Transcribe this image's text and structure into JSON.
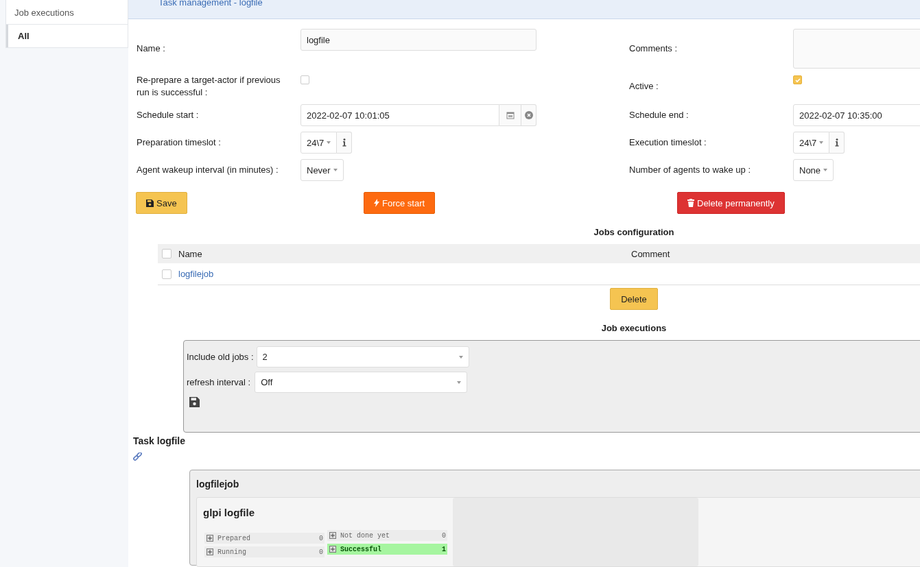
{
  "sidebar": {
    "title": "Job executions",
    "items": [
      {
        "label": "All",
        "selected": true
      }
    ]
  },
  "header": {
    "title": "Task management - logfile"
  },
  "form": {
    "rows": [
      {
        "left": {
          "label": "Name :",
          "kind": "text",
          "value": "logfile"
        },
        "right": {
          "label": "Comments :",
          "kind": "textarea"
        }
      },
      {
        "left": {
          "label": "Re-prepare a target-actor if previous run is successful :",
          "kind": "checkbox",
          "checked": false
        },
        "right": {
          "label": "Active :",
          "kind": "checkbox",
          "checked": true
        }
      },
      {
        "left": {
          "label": "Schedule start :",
          "kind": "date",
          "value": "2022-02-07 10:01:05",
          "buttons_shown": true
        },
        "right": {
          "label": "Schedule end :",
          "kind": "date",
          "value": "2022-02-07 10:35:00"
        }
      },
      {
        "left": {
          "label": "Preparation timeslot :",
          "kind": "timeslot",
          "value": "24\\7"
        },
        "right": {
          "label": "Execution timeslot :",
          "kind": "timeslot",
          "value": "24\\7"
        }
      },
      {
        "left": {
          "label": "Agent wakeup interval (in minutes) :",
          "kind": "select",
          "value": "Never"
        },
        "right": {
          "label": "Number of agents to wake up :",
          "kind": "select",
          "value": "None"
        }
      }
    ],
    "buttons": [
      {
        "label": "Save",
        "kind": "save"
      },
      {
        "label": "Force start",
        "kind": "force"
      },
      {
        "label": "Delete permanently",
        "kind": "delete"
      }
    ]
  },
  "jobs": {
    "title": "Jobs configuration",
    "columns": [
      "Name",
      "Comment"
    ],
    "select_all_checked": false,
    "rows": [
      {
        "name": "logfilejob",
        "checked": false
      }
    ],
    "delete_button": "Delete"
  },
  "executions": {
    "title": "Job executions",
    "include_label": "Include old jobs :",
    "include_value": "2",
    "refresh_label": "refresh interval :",
    "refresh_value": "Off"
  },
  "task": {
    "title": "Task logfile",
    "job": "logfilejob",
    "agent": "glpi logfile",
    "counters": [
      [
        {
          "label": "Prepared",
          "count": "0",
          "highlighted": false
        },
        {
          "label": "Running",
          "count": "0",
          "highlighted": false
        }
      ],
      [
        {
          "label": "Not done yet",
          "count": "0",
          "highlighted": false
        },
        {
          "label": "Successful",
          "count": "1",
          "highlighted": true
        }
      ]
    ]
  }
}
